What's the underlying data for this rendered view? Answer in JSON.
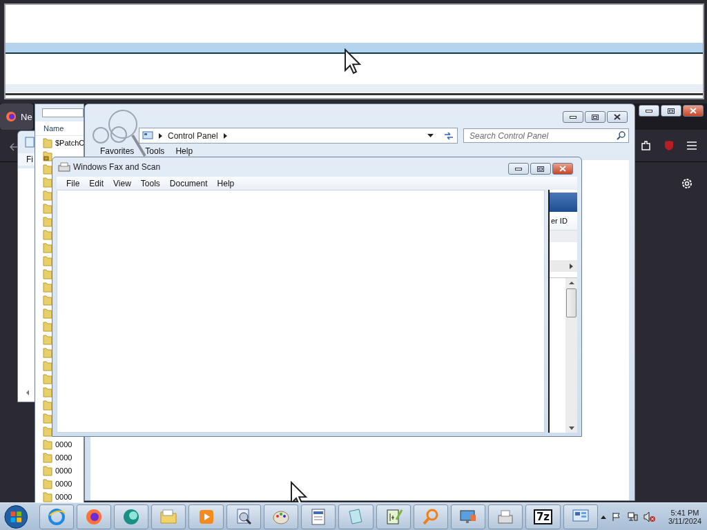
{
  "browser": {
    "tab_title": "Ne"
  },
  "notepad": {
    "menu": [
      "Fi"
    ]
  },
  "explorer": {
    "column": "Name",
    "rows": [
      {
        "name": "$PatchC",
        "locked": false
      },
      {
        "locked": true
      },
      {
        "locked": false
      },
      {
        "locked": false
      },
      {
        "locked": false
      },
      {
        "locked": false
      },
      {
        "locked": false
      },
      {
        "locked": false
      },
      {
        "locked": false
      },
      {
        "locked": false
      },
      {
        "locked": false
      },
      {
        "locked": false
      },
      {
        "locked": false
      },
      {
        "locked": false
      },
      {
        "locked": false
      },
      {
        "locked": false
      },
      {
        "locked": false
      },
      {
        "locked": false
      },
      {
        "locked": false
      },
      {
        "locked": false
      },
      {
        "locked": false
      },
      {
        "locked": false
      },
      {
        "locked": false
      },
      {
        "name": "0000",
        "locked": false
      },
      {
        "name": "0000",
        "locked": false
      },
      {
        "name": "0000",
        "locked": false
      },
      {
        "name": "0000",
        "locked": false
      },
      {
        "name": "0000",
        "locked": false
      }
    ]
  },
  "control_panel": {
    "breadcrumb": [
      "Control Panel"
    ],
    "search": {
      "placeholder": "Search Control Panel"
    },
    "menu": [
      "Favorites",
      "Tools",
      "Help"
    ]
  },
  "fax": {
    "title": "Windows Fax and Scan",
    "menu": [
      "File",
      "Edit",
      "View",
      "Tools",
      "Document",
      "Help"
    ],
    "side_column": "er ID"
  },
  "taskbar": {
    "apps": [
      {
        "kind": "ie"
      },
      {
        "kind": "firefox"
      },
      {
        "kind": "orb"
      },
      {
        "kind": "folder"
      },
      {
        "kind": "media"
      },
      {
        "kind": "viewer"
      },
      {
        "kind": "paint"
      },
      {
        "kind": "wordpad"
      },
      {
        "kind": "notepad"
      },
      {
        "kind": "notepadpp"
      },
      {
        "kind": "search"
      },
      {
        "kind": "monitor"
      },
      {
        "kind": "fax"
      },
      {
        "kind": "sevenzip",
        "label": "7z"
      },
      {
        "kind": "panel"
      }
    ],
    "time": "5:41 PM",
    "date": "3/11/2024"
  }
}
